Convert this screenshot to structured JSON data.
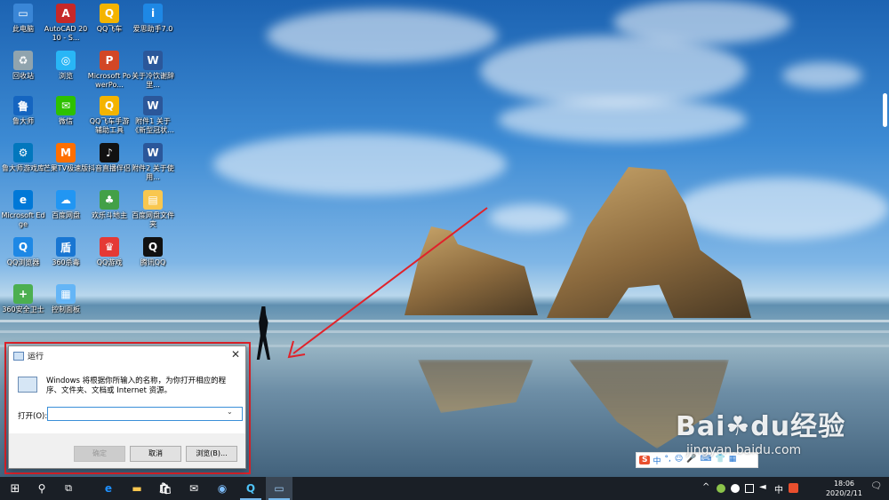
{
  "desktop_icons": [
    {
      "label": "此电脑",
      "color": "#3a86d6",
      "glyph": "▭"
    },
    {
      "label": "AutoCAD 2010 - S...",
      "color": "#c62828",
      "glyph": "A"
    },
    {
      "label": "QQ飞车",
      "color": "#f4b400",
      "glyph": "Q"
    },
    {
      "label": "爱思助手7.0",
      "color": "#1e88e5",
      "glyph": "i"
    },
    {
      "label": "回收站",
      "color": "#90a4ae",
      "glyph": "♻"
    },
    {
      "label": "浏览",
      "color": "#29b6f6",
      "glyph": "◎"
    },
    {
      "label": "Microsoft PowerPo...",
      "color": "#d24726",
      "glyph": "P"
    },
    {
      "label": "关于冷饮谢辞里...",
      "color": "#2b579a",
      "glyph": "W"
    },
    {
      "label": "鲁大师",
      "color": "#1565c0",
      "glyph": "鲁"
    },
    {
      "label": "微信",
      "color": "#2dc100",
      "glyph": "✉"
    },
    {
      "label": "QQ飞车手游辅助工具",
      "color": "#f4b400",
      "glyph": "Q"
    },
    {
      "label": "附件1 关于《新型冠状...",
      "color": "#2b579a",
      "glyph": "W"
    },
    {
      "label": "鲁大师游戏库",
      "color": "#0277bd",
      "glyph": "⚙"
    },
    {
      "label": "芒果TV极速版",
      "color": "#ff6f00",
      "glyph": "M"
    },
    {
      "label": "抖音直播伴侣",
      "color": "#111111",
      "glyph": "♪"
    },
    {
      "label": "附件2 关于使用...",
      "color": "#2b579a",
      "glyph": "W"
    },
    {
      "label": "Microsoft Edge",
      "color": "#0078d7",
      "glyph": "e"
    },
    {
      "label": "百度网盘",
      "color": "#2196f3",
      "glyph": "☁"
    },
    {
      "label": "欢乐斗地主",
      "color": "#43a047",
      "glyph": "♣"
    },
    {
      "label": "百度网盘文件夹",
      "color": "#f9c74f",
      "glyph": "▤"
    },
    {
      "label": "QQ浏览器",
      "color": "#1e88e5",
      "glyph": "Q"
    },
    {
      "label": "360杀毒",
      "color": "#1976d2",
      "glyph": "盾"
    },
    {
      "label": "QQ游戏",
      "color": "#e53935",
      "glyph": "♛"
    },
    {
      "label": "腾讯QQ",
      "color": "#111111",
      "glyph": "Q"
    },
    {
      "label": "360安全卫士",
      "color": "#4caf50",
      "glyph": "+"
    },
    {
      "label": "控制面板",
      "color": "#64b5f6",
      "glyph": "▦"
    }
  ],
  "run_dialog": {
    "title": "运行",
    "close_glyph": "✕",
    "description": "Windows 将根据你所输入的名称，为你打开相应的程序、文件夹、文档或 Internet 资源。",
    "open_label": "打开(O):",
    "input_value": "",
    "dropdown_glyph": "⌄",
    "ok_label": "确定",
    "cancel_label": "取消",
    "browse_label": "浏览(B)..."
  },
  "ime_bar": {
    "logo": "S",
    "items": [
      "中",
      "°,",
      "☺",
      "🎤",
      "⌨",
      "👕",
      "▦"
    ]
  },
  "watermark": {
    "main": "Bai☘du经验",
    "sub": "jingyan.baidu.com"
  },
  "taskbar": {
    "start_glyph": "⊞",
    "search_glyph": "⚲",
    "taskview_glyph": "⧉",
    "apps": [
      {
        "name": "edge",
        "glyph": "e",
        "color": "#1e90ff"
      },
      {
        "name": "explorer",
        "glyph": "▬",
        "color": "#f9c74f"
      },
      {
        "name": "store",
        "glyph": "🛍",
        "color": "#ffffff"
      },
      {
        "name": "mail",
        "glyph": "✉",
        "color": "#ffffff"
      },
      {
        "name": "browser",
        "glyph": "◉",
        "color": "#7fbfff"
      },
      {
        "name": "qq-browser",
        "glyph": "Q",
        "color": "#4fc3f7"
      },
      {
        "name": "run",
        "glyph": "▭",
        "color": "#9ecbf5"
      }
    ],
    "tray": {
      "chevron": "^",
      "ime_cn": "中",
      "time": "18:06",
      "date": "2020/2/11",
      "notification_glyph": "🗨"
    }
  }
}
